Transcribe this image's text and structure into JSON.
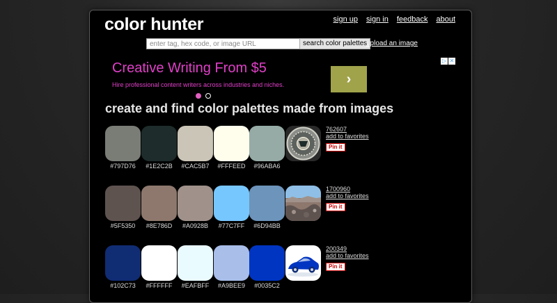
{
  "site": {
    "logo": "color hunter"
  },
  "nav": {
    "signup": "sign up",
    "signin": "sign in",
    "feedback": "feedback",
    "about": "about"
  },
  "search": {
    "placeholder": "enter tag, hex code, or image URL",
    "button": "search color palettes",
    "upload": "upload an image"
  },
  "ad": {
    "title": "Creative Writing From $5",
    "subtitle": "Hire professional content writers across industries and niches.",
    "cta_icon": "chevron-right-icon",
    "color_title": "#e040c8",
    "color_button": "#a0a34a"
  },
  "headline": "create and find color palettes made from images",
  "palettes": [
    {
      "id": "762607",
      "fav": "add to favorites",
      "pin": "Pin it",
      "image": "coin-medallion",
      "colors": [
        "#797D76",
        "#1E2C2B",
        "#CAC5B7",
        "#FFFEED",
        "#96ABA6"
      ]
    },
    {
      "id": "1700960",
      "fav": "add to favorites",
      "pin": "Pin it",
      "image": "rocky-landscape",
      "colors": [
        "#5F5350",
        "#8E786D",
        "#A0928B",
        "#77C7FF",
        "#6D94BB"
      ]
    },
    {
      "id": "200349",
      "fav": "add to favorites",
      "pin": "Pin it",
      "image": "blue-sports-car",
      "colors": [
        "#102C73",
        "#FFFFFF",
        "#EAFBFF",
        "#A9BEE9",
        "#0035C2"
      ]
    }
  ]
}
